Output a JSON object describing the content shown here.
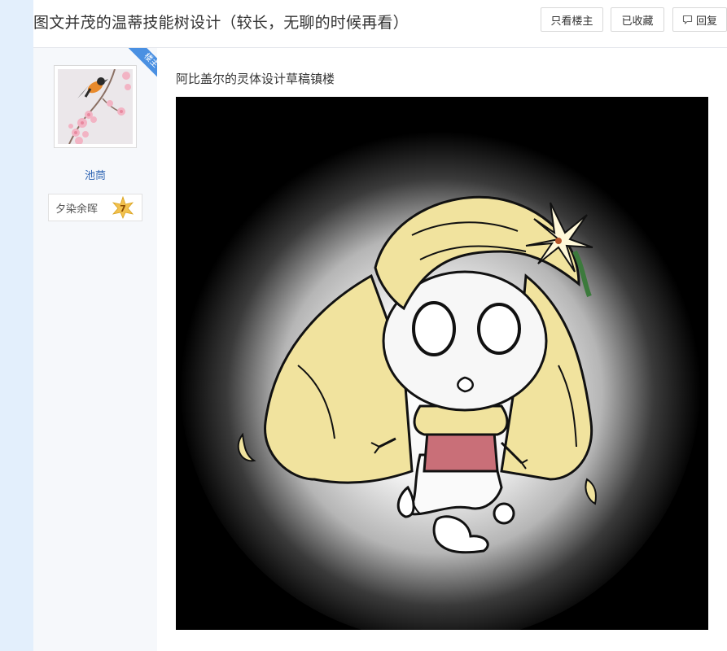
{
  "thread": {
    "title": "图文并茂的温蒂技能树设计（较长，无聊的时候再看）"
  },
  "header_buttons": {
    "only_op": "只看楼主",
    "favorited": "已收藏",
    "reply": "回复"
  },
  "author": {
    "badge": "楼主",
    "name": "池茼",
    "level_name": "夕染余晖",
    "level": "7"
  },
  "post": {
    "text": "阿比盖尔的灵体设计草稿镇楼"
  },
  "colors": {
    "left_strip": "#e3effc",
    "author_bg": "#f6f8fb",
    "username": "#2d64b3",
    "badge": "#4a90e2",
    "hair": "#f1e39e",
    "level_star": "#f2c14e"
  }
}
